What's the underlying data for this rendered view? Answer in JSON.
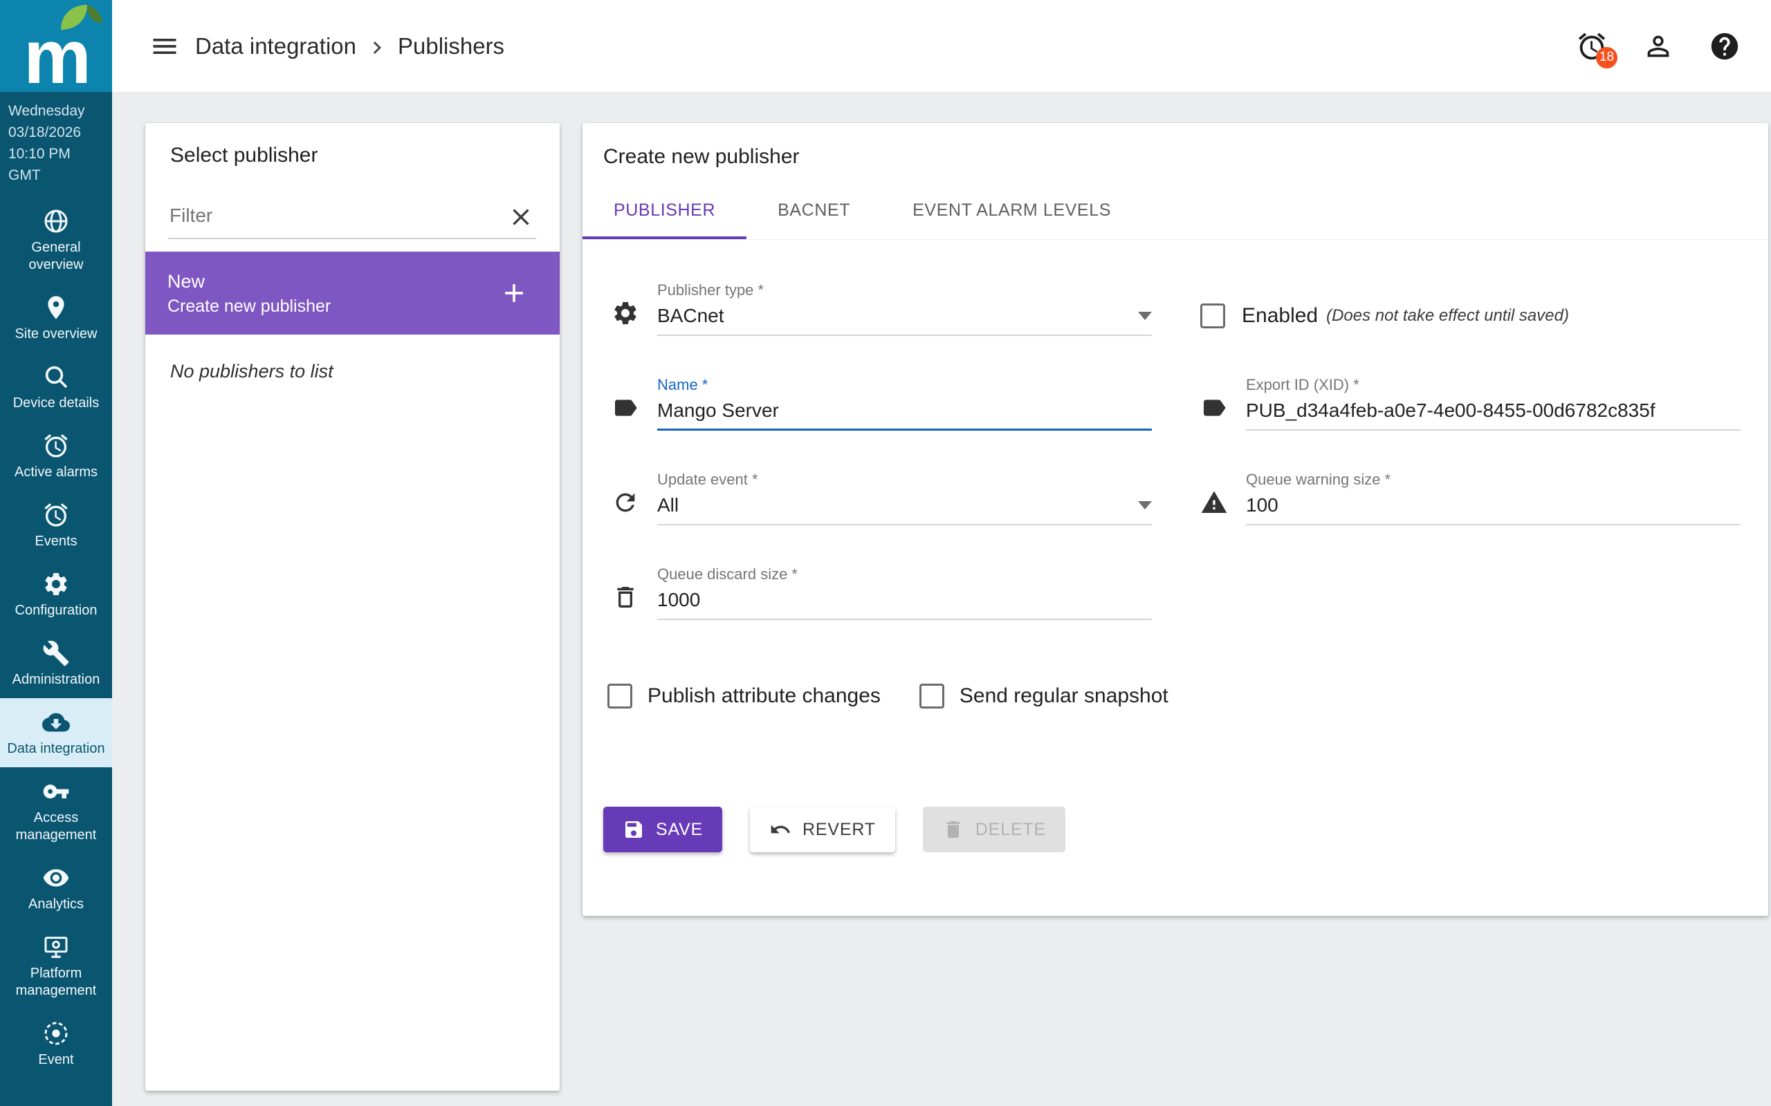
{
  "colors": {
    "accent": "#673ab7",
    "accent-light": "#7e57c2",
    "focus-blue": "#1565c0",
    "sidebar-bg": "#0a5570",
    "logo-bg": "#0c84ae",
    "active-bg": "#d9edf7",
    "badge": "#f4511e"
  },
  "sidebar": {
    "logo": "m",
    "datetime": {
      "day": "Wednesday",
      "date": "03/18/2026",
      "time": "10:10 PM",
      "tz": "GMT"
    },
    "items": [
      {
        "label": "General overview",
        "icon": "globe-icon"
      },
      {
        "label": "Site overview",
        "icon": "location-pin-icon"
      },
      {
        "label": "Device details",
        "icon": "search-icon"
      },
      {
        "label": "Active alarms",
        "icon": "alarm-clock-icon"
      },
      {
        "label": "Events",
        "icon": "alarm-clock-icon"
      },
      {
        "label": "Configuration",
        "icon": "gear-icon"
      },
      {
        "label": "Administration",
        "icon": "wrench-icon"
      },
      {
        "label": "Data integration",
        "icon": "cloud-download-icon",
        "active": true
      },
      {
        "label": "Access management",
        "icon": "key-icon"
      },
      {
        "label": "Analytics",
        "icon": "eye-icon"
      },
      {
        "label": "Platform management",
        "icon": "monitor-icon"
      },
      {
        "label": "Event",
        "icon": "gear-circle-icon"
      }
    ]
  },
  "topbar": {
    "breadcrumb": {
      "parent": "Data integration",
      "current": "Publishers"
    },
    "alarm_badge": "18"
  },
  "publisher_list": {
    "title": "Select publisher",
    "filter_placeholder": "Filter",
    "new_item": {
      "title": "New",
      "subtitle": "Create new publisher"
    },
    "empty_message": "No publishers to list"
  },
  "editor": {
    "title": "Create new publisher",
    "tabs": [
      {
        "label": "PUBLISHER",
        "active": true
      },
      {
        "label": "BACNET",
        "active": false
      },
      {
        "label": "EVENT ALARM LEVELS",
        "active": false
      }
    ],
    "fields": {
      "publisher_type": {
        "label": "Publisher type *",
        "value": "BACnet"
      },
      "enabled": {
        "label": "Enabled",
        "note": "(Does not take effect until saved)",
        "checked": false
      },
      "name": {
        "label": "Name *",
        "value": "Mango Server"
      },
      "xid": {
        "label": "Export ID (XID) *",
        "value": "PUB_d34a4feb-a0e7-4e00-8455-00d6782c835f"
      },
      "update_event": {
        "label": "Update event *",
        "value": "All"
      },
      "queue_warning": {
        "label": "Queue warning size *",
        "value": "100"
      },
      "queue_discard": {
        "label": "Queue discard size *",
        "value": "1000"
      },
      "publish_attribute_changes": {
        "label": "Publish attribute changes",
        "checked": false
      },
      "send_regular_snapshot": {
        "label": "Send regular snapshot",
        "checked": false
      }
    },
    "buttons": {
      "save": "SAVE",
      "revert": "REVERT",
      "delete": "DELETE"
    }
  }
}
